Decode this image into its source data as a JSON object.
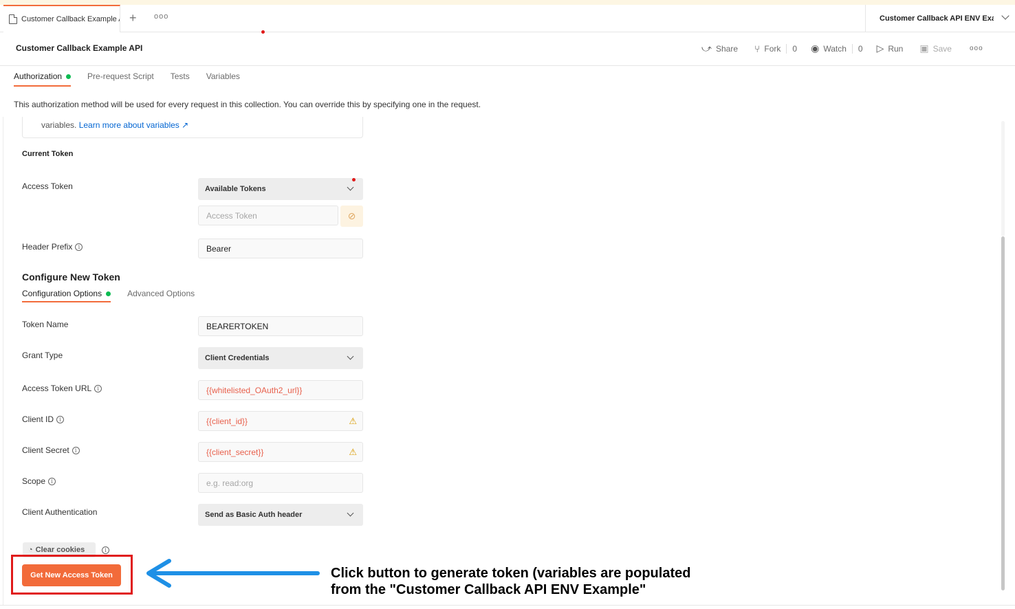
{
  "tabbar": {
    "tab_title": "Customer Callback Example API",
    "plus": "+",
    "more": "ooo",
    "environment": "Customer Callback API ENV Example"
  },
  "header": {
    "title": "Customer Callback Example API",
    "share": "Share",
    "fork": "Fork",
    "fork_count": "0",
    "watch": "Watch",
    "watch_count": "0",
    "run": "Run",
    "save": "Save",
    "more": "ooo"
  },
  "subtabs": [
    "Authorization",
    "Pre-request Script",
    "Tests",
    "Variables"
  ],
  "description": "This authorization method will be used for every request in this collection. You can override this by specifying one in the request.",
  "note": {
    "prefix": "variables.",
    "link": "Learn more about variables ↗"
  },
  "current_token": {
    "heading": "Current Token",
    "access_token_label": "Access Token",
    "available_tokens": "Available Tokens",
    "access_token_placeholder": "Access Token",
    "header_prefix_label": "Header Prefix",
    "header_prefix_value": "Bearer"
  },
  "configure": {
    "heading": "Configure New Token",
    "tabs": [
      "Configuration Options",
      "Advanced Options"
    ],
    "token_name_label": "Token Name",
    "token_name_value": "BEARERTOKEN",
    "grant_type_label": "Grant Type",
    "grant_type_value": "Client Credentials",
    "access_token_url_label": "Access Token URL",
    "access_token_url_value": "{{whitelisted_OAuth2_url}}",
    "client_id_label": "Client ID",
    "client_id_value": "{{client_id}}",
    "client_secret_label": "Client Secret",
    "client_secret_value": "{{client_secret}}",
    "scope_label": "Scope",
    "scope_placeholder": "e.g. read:org",
    "client_auth_label": "Client Authentication",
    "client_auth_value": "Send as Basic Auth header"
  },
  "buttons": {
    "clear_cookies": "Clear cookies",
    "get_new_token": "Get New Access Token"
  },
  "annotation": {
    "line1": "Click button to generate token (variables are populated",
    "line2": "from the \"Customer Callback API ENV Example\""
  },
  "colors": {
    "accent": "#f26b3a",
    "variable_text": "#e8604c",
    "highlight": "#e01a1a",
    "arrow": "#1e90e6",
    "status_green": "#0cbb52"
  },
  "icons": [
    "document-icon",
    "share-icon",
    "fork-icon",
    "eye-icon",
    "run-icon",
    "save-icon",
    "info-icon",
    "warning-icon",
    "eye-off-icon",
    "cookie-icon",
    "chevron-down-icon"
  ]
}
